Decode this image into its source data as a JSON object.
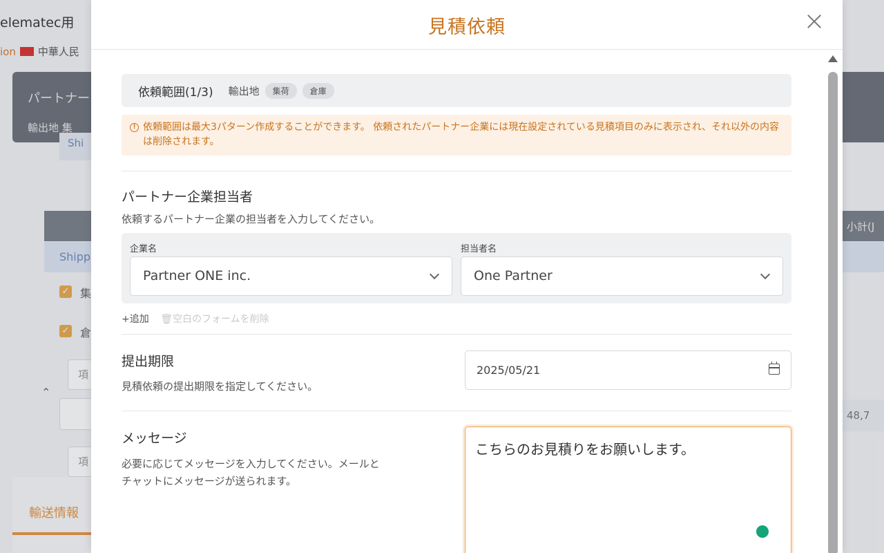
{
  "background": {
    "title": "elematec用",
    "sub_left": "ion",
    "sub_country": "中華人民",
    "card_title": "パートナー",
    "card_sub": "輸出地",
    "card_sub2": "集",
    "shi": "Shi",
    "ship": "Shipp",
    "subtotal_header": "小計(J",
    "checkbox_1_label": "集",
    "checkbox_2_label": "倉",
    "field_placeholder": "項",
    "amount": "48,7",
    "tab_label": "輸送情報"
  },
  "modal": {
    "title": "見積依頼",
    "range": {
      "title": "依頼範囲(1/3)",
      "export_label": "輸出地",
      "chips": [
        "集荷",
        "倉庫"
      ]
    },
    "notice": "依頼範囲は最大3パターン作成することができます。 依頼されたパートナー企業には現在設定されている見積項目のみに表示され、それ以外の内容は削除されます。",
    "partner": {
      "heading": "パートナー企業担当者",
      "description": "依頼するパートナー企業の担当者を入力してください。",
      "company_label": "企業名",
      "company_value": "Partner ONE inc.",
      "contact_label": "担当者名",
      "contact_value": "One Partner",
      "add_label": "+追加",
      "delete_label": "空白のフォームを削除"
    },
    "deadline": {
      "heading": "提出期限",
      "description": "見積依頼の提出期限を指定してください。",
      "value": "2025/05/21"
    },
    "message": {
      "heading": "メッセージ",
      "description_line1": "必要に応じてメッセージを入力してください。メールと",
      "description_line2": "チャットにメッセージが送られます。",
      "value": "こちらのお見積りをお願いします。"
    }
  },
  "colors": {
    "accent": "#c8741e",
    "notice_bg": "#fdf0e4",
    "status_dot": "#15a37a"
  }
}
